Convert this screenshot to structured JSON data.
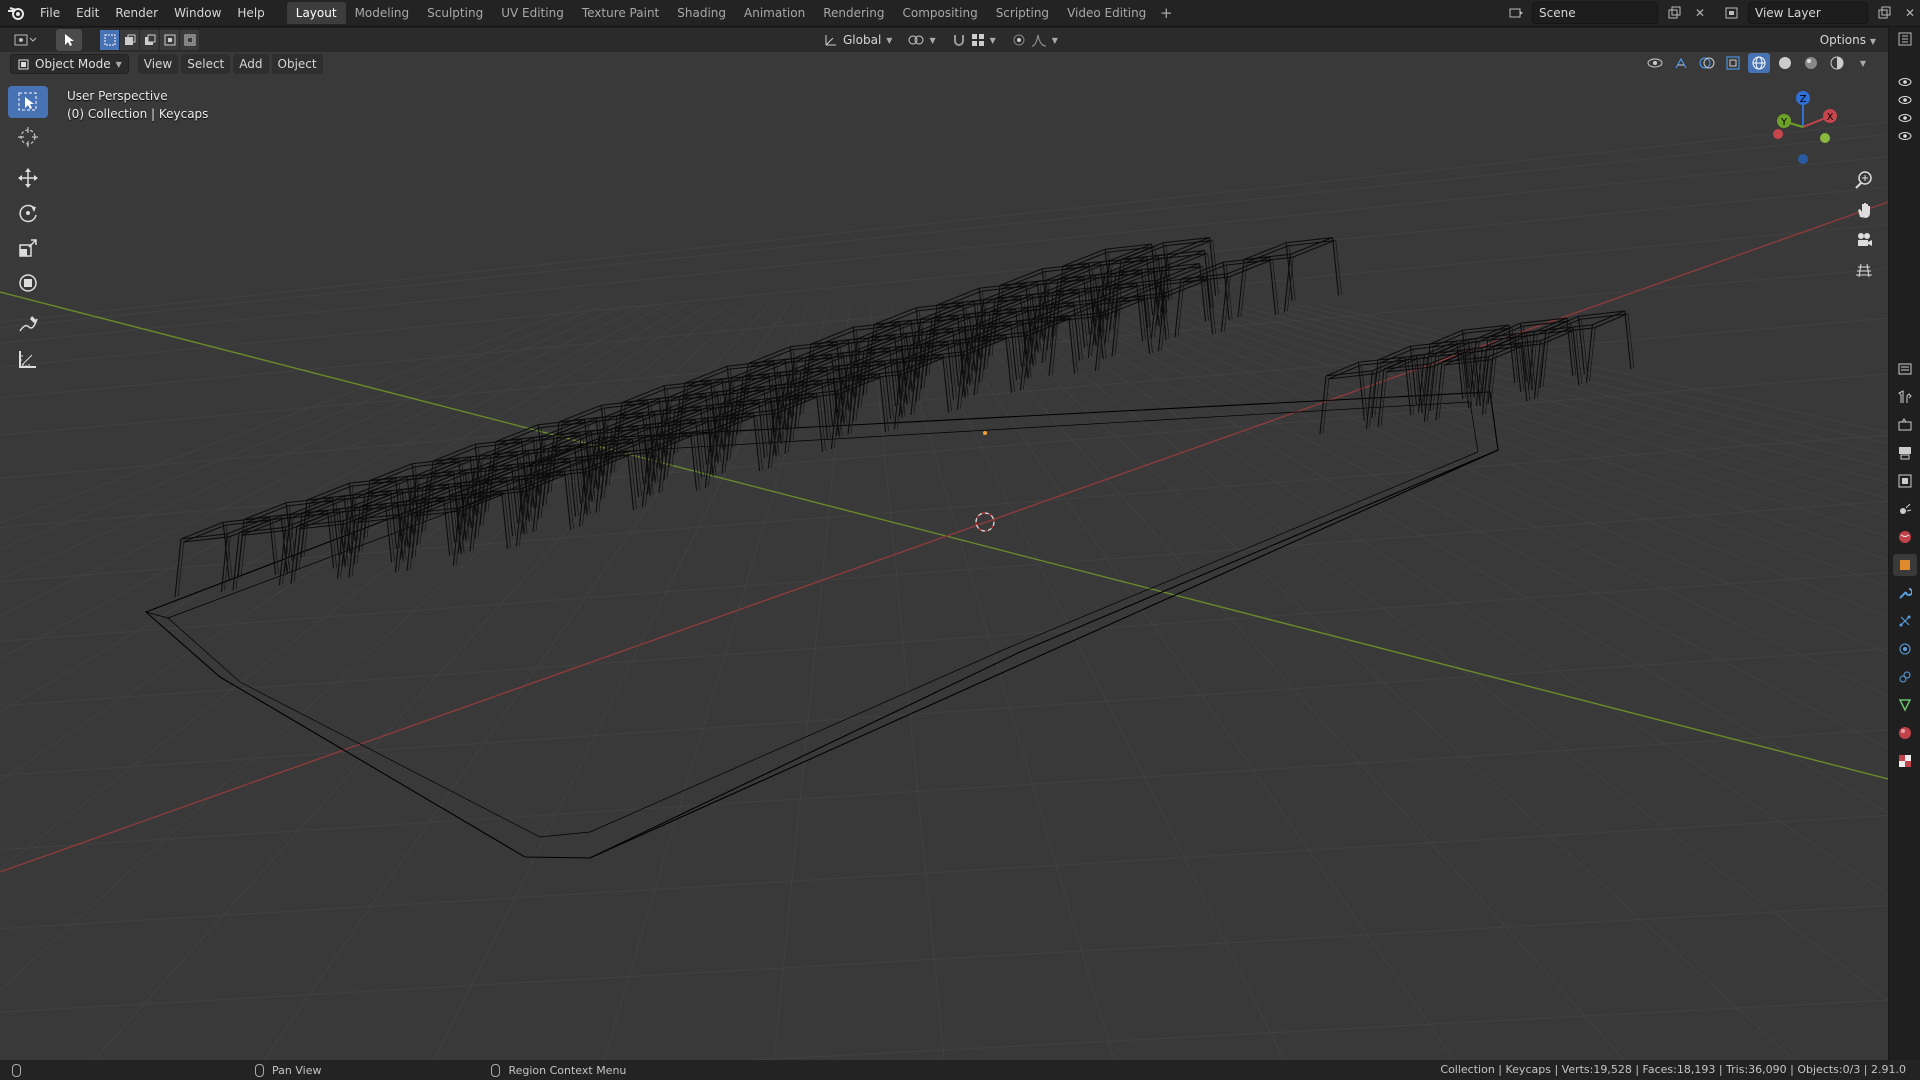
{
  "menu": [
    "File",
    "Edit",
    "Render",
    "Window",
    "Help"
  ],
  "workspaces": [
    "Layout",
    "Modeling",
    "Sculpting",
    "UV Editing",
    "Texture Paint",
    "Shading",
    "Animation",
    "Rendering",
    "Compositing",
    "Scripting",
    "Video Editing"
  ],
  "active_workspace": "Layout",
  "scene": {
    "name": "Scene",
    "view_layer": "View Layer"
  },
  "tool_header": {
    "orientation": "Global",
    "options_label": "Options"
  },
  "viewport_header": {
    "mode": "Object Mode",
    "menus": [
      "View",
      "Select",
      "Add",
      "Object"
    ]
  },
  "overlay": {
    "line1": "User Perspective",
    "line2": "(0) Collection | Keycaps"
  },
  "gizmo": {
    "x": "X",
    "y": "Y",
    "z": "Z"
  },
  "status": {
    "hint1": "Pan View",
    "hint2": "Region Context Menu",
    "info": "Collection | Keycaps | Verts:19,528 | Faces:18,193 | Tris:36,090 | Objects:0/3 | 2.91.0"
  },
  "colors": {
    "accent": "#4772b3",
    "axis_x": "#9b3a3a",
    "axis_y": "#6a8a2a",
    "axis_z": "#2f6fd6"
  }
}
